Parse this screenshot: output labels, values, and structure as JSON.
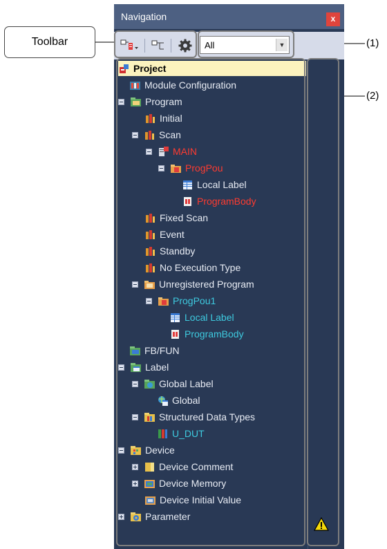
{
  "window": {
    "title": "Navigation",
    "close_label": "x"
  },
  "toolbar": {
    "filter": {
      "value": "All"
    }
  },
  "annotations": {
    "toolbar_label": "Toolbar",
    "label_1": "(1)",
    "label_2": "(2)"
  },
  "tree": [
    {
      "label": "Project",
      "selected": true
    },
    {
      "label": "Module Configuration"
    },
    {
      "label": "Program"
    },
    {
      "label": "Initial"
    },
    {
      "label": "Scan"
    },
    {
      "label": "MAIN"
    },
    {
      "label": "ProgPou"
    },
    {
      "label": "Local Label"
    },
    {
      "label": "ProgramBody"
    },
    {
      "label": "Fixed Scan"
    },
    {
      "label": "Event"
    },
    {
      "label": "Standby"
    },
    {
      "label": "No Execution Type"
    },
    {
      "label": "Unregistered Program"
    },
    {
      "label": "ProgPou1"
    },
    {
      "label": "Local Label"
    },
    {
      "label": "ProgramBody"
    },
    {
      "label": "FB/FUN"
    },
    {
      "label": "Label"
    },
    {
      "label": "Global Label"
    },
    {
      "label": "Global"
    },
    {
      "label": "Structured Data Types"
    },
    {
      "label": "U_DUT"
    },
    {
      "label": "Device"
    },
    {
      "label": "Device Comment"
    },
    {
      "label": "Device Memory"
    },
    {
      "label": "Device Initial Value"
    },
    {
      "label": "Parameter"
    }
  ],
  "colors": {
    "panel": "#293955",
    "title_bar": "#4d6082",
    "selected": "#fbf2be",
    "red_text": "#ff3b30",
    "cyan_text": "#3ecbe0"
  }
}
